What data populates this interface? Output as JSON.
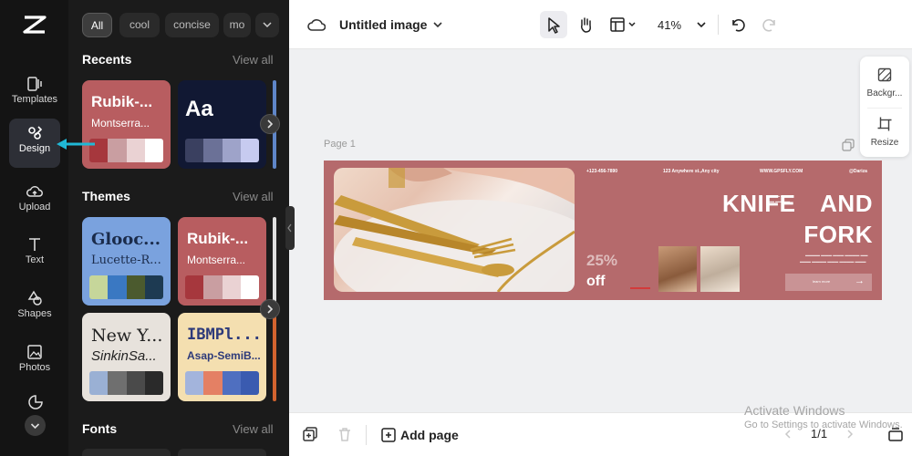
{
  "rail": {
    "items": [
      {
        "label": "Templates"
      },
      {
        "label": "Design"
      },
      {
        "label": "Upload"
      },
      {
        "label": "Text"
      },
      {
        "label": "Shapes"
      },
      {
        "label": "Photos"
      }
    ]
  },
  "panel": {
    "chips": [
      "All",
      "cool",
      "concise",
      "mo"
    ],
    "recents": {
      "title": "Recents",
      "view_all": "View all",
      "cards": [
        {
          "title": "Rubik-...",
          "subtitle": "Montserra...",
          "bg": "#b85d60",
          "swatches": [
            "#a6373d",
            "#c99ea1",
            "#ead2d3",
            "#ffffff"
          ]
        },
        {
          "title": "Aa",
          "subtitle": "",
          "bg": "#111833",
          "swatches": [
            "#3a4060",
            "#6b7197",
            "#9ea3c9",
            "#c7cbf0"
          ]
        }
      ]
    },
    "themes": {
      "title": "Themes",
      "view_all": "View all",
      "cards": [
        {
          "title": "Glooc...",
          "subtitle": "Lucette-R...",
          "bg": "#7aa2de",
          "swatches": [
            "#c6d69a",
            "#3a78c2",
            "#4b5a2e",
            "#1d3a52"
          ]
        },
        {
          "title": "Rubik-...",
          "subtitle": "Montserra...",
          "bg": "#b85d60",
          "swatches": [
            "#a6373d",
            "#c99ea1",
            "#ead2d3",
            "#ffffff"
          ]
        },
        {
          "title": "New Y...",
          "subtitle": "SinkinSa...",
          "bg": "#e7e2dc",
          "swatches": [
            "#9ab0d4",
            "#6f6f6f",
            "#4a4a4a",
            "#2a2a2a"
          ]
        },
        {
          "title": "IBMPl...",
          "subtitle": "Asap-SemiB...",
          "bg": "#f4dfb0",
          "swatches": [
            "#a3b4dc",
            "#e48064",
            "#4f6fc0",
            "#3a5bb0"
          ]
        }
      ]
    },
    "fonts": {
      "title": "Fonts",
      "view_all": "View all"
    }
  },
  "topbar": {
    "title": "Untitled image",
    "zoom": "41%"
  },
  "side_tools": [
    {
      "label": "Backgr..."
    },
    {
      "label": "Resize"
    }
  ],
  "canvas": {
    "page_label": "Page 1",
    "design": {
      "contacts": [
        "+123-456-7890",
        "123 Anywhere st.,Any city",
        "WWW.GPSFLY.COM",
        "@Dariza"
      ],
      "title_line1_a": "KNIFE",
      "title_line1_b": "AND",
      "title_line2": "FORK",
      "percent": "25%",
      "off": "off",
      "learn_more": "learn more",
      "arrow": "→"
    }
  },
  "bottombar": {
    "add_page": "Add page",
    "pager": "1/1"
  },
  "watermark": {
    "line1": "Activate Windows",
    "line2": "Go to Settings to activate Windows."
  },
  "colors": {
    "accent_arrow": "#20b8d6",
    "design_bg": "#b56a6c"
  }
}
